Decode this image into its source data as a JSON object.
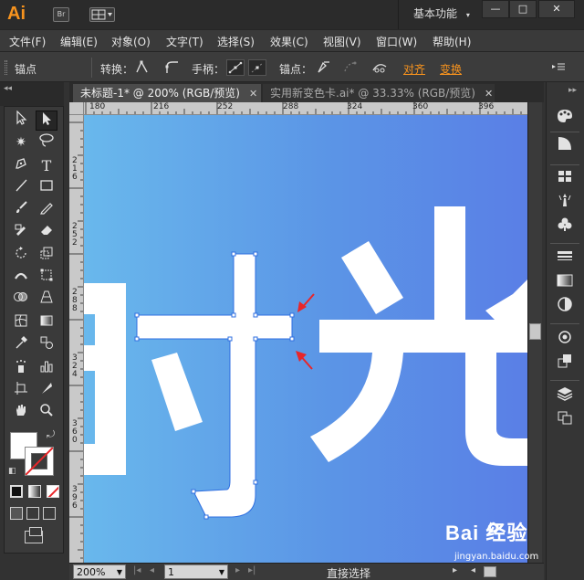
{
  "app": {
    "logo": "Ai",
    "bridge_label": "Br",
    "workspace": "基本功能",
    "window_controls": [
      "—",
      "□",
      "✕"
    ]
  },
  "menu": [
    "文件(F)",
    "编辑(E)",
    "对象(O)",
    "文字(T)",
    "选择(S)",
    "效果(C)",
    "视图(V)",
    "窗口(W)",
    "帮助(H)"
  ],
  "control_bar": {
    "context_label": "锚点",
    "convert_label": "转换：",
    "handles_label": "手柄：",
    "anchor_label": "锚点：",
    "align_link": "对齐",
    "transform_link": "变换"
  },
  "tabs": [
    {
      "label": "未标题-1* @ 200% (RGB/预览)",
      "close": "✕"
    },
    {
      "label": "实用新变色卡.ai* @ 33.33% (RGB/预览)",
      "close": "✕"
    }
  ],
  "ruler": {
    "h_ticks": [
      "180",
      "216",
      "252",
      "288",
      "324",
      "360",
      "396"
    ],
    "v_ticks": [
      "216",
      "252",
      "288",
      "324",
      "360",
      "396"
    ]
  },
  "canvas": {
    "char_1": "时",
    "char_2": "光",
    "gradient": [
      "#69b8ec",
      "#5a7fe6"
    ],
    "arrow_color": "#e8262a"
  },
  "status": {
    "zoom": "200%",
    "page": "1",
    "tool_name": "直接选择"
  },
  "watermark": {
    "logo": "Bai 经验",
    "url": "jingyan.baidu.com"
  },
  "colors": {
    "accent": "#f7931e",
    "selection": "#2f6fe0"
  }
}
